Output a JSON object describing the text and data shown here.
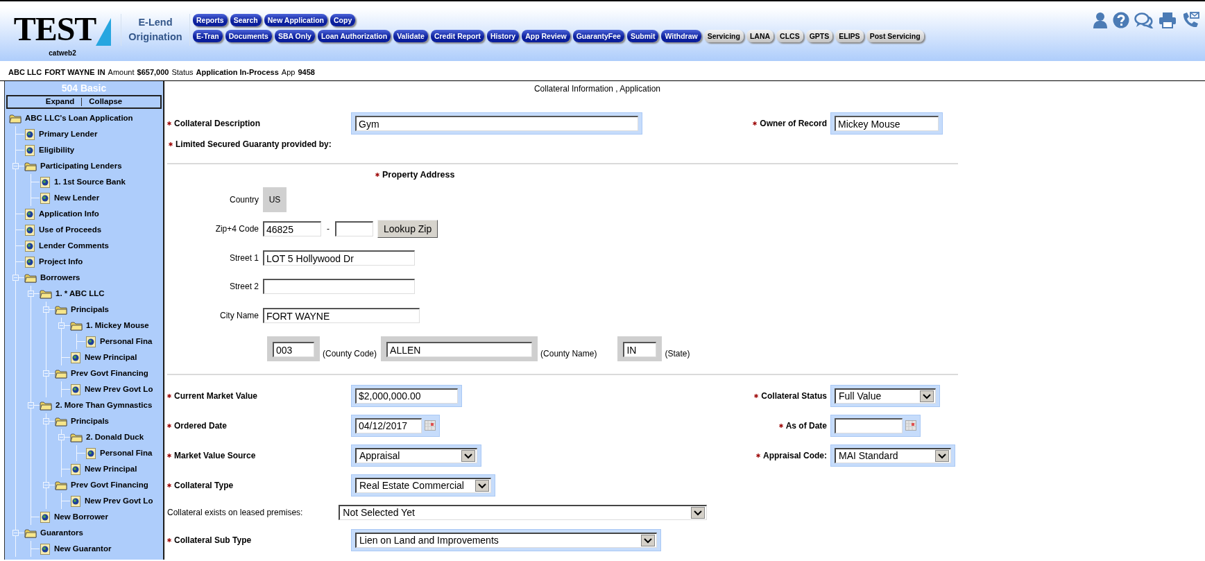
{
  "header": {
    "logo": {
      "text": "TEST",
      "subtitle": "catweb2"
    },
    "app_name": "E-Lend Origination",
    "nav_buttons": [
      [
        {
          "label": "Reports",
          "kind": "primary"
        },
        {
          "label": "Search",
          "kind": "primary"
        },
        {
          "label": "New Application",
          "kind": "primary"
        },
        {
          "label": "Copy",
          "kind": "primary"
        }
      ],
      [
        {
          "label": "E-Tran",
          "kind": "primary"
        },
        {
          "label": "Documents",
          "kind": "primary"
        },
        {
          "label": "SBA Only",
          "kind": "primary"
        },
        {
          "label": "Loan Authorization",
          "kind": "primary"
        },
        {
          "label": "Validate",
          "kind": "primary"
        },
        {
          "label": "Credit Report",
          "kind": "primary"
        },
        {
          "label": "History",
          "kind": "primary"
        },
        {
          "label": "App Review",
          "kind": "primary"
        },
        {
          "label": "GuarantyFee",
          "kind": "primary"
        },
        {
          "label": "Submit",
          "kind": "primary"
        },
        {
          "label": "Withdraw",
          "kind": "primary"
        },
        {
          "label": "Servicing",
          "kind": "secondary"
        },
        {
          "label": "LANA",
          "kind": "secondary"
        },
        {
          "label": "CLCS",
          "kind": "secondary"
        },
        {
          "label": "GPTS",
          "kind": "secondary"
        },
        {
          "label": "ELIPS",
          "kind": "secondary"
        },
        {
          "label": "Post Servicing",
          "kind": "secondary"
        }
      ]
    ]
  },
  "summary": [
    {
      "text": "ABC LLC",
      "kind": "value"
    },
    {
      "text": "FORT WAYNE",
      "kind": "value"
    },
    {
      "text": "IN",
      "kind": "value"
    },
    {
      "text": "Amount",
      "kind": "label"
    },
    {
      "text": "$657,000",
      "kind": "value"
    },
    {
      "text": "Status",
      "kind": "label"
    },
    {
      "text": "Application In-Process",
      "kind": "value"
    },
    {
      "text": "App",
      "kind": "label"
    },
    {
      "text": "9458",
      "kind": "value"
    }
  ],
  "sidebar": {
    "title": "504 Basic",
    "expand": "Expand",
    "collapse": "Collapse",
    "tree": [
      {
        "label": "ABC LLC's Loan Application",
        "kind": "folder",
        "children": [
          {
            "label": "Primary Lender",
            "kind": "page"
          },
          {
            "label": "Eligibility",
            "kind": "page"
          },
          {
            "label": "Participating Lenders",
            "kind": "folder",
            "children": [
              {
                "label": "1. 1st Source Bank",
                "kind": "page"
              },
              {
                "label": "New Lender",
                "kind": "page"
              }
            ]
          },
          {
            "label": "Application Info",
            "kind": "page"
          },
          {
            "label": "Use of Proceeds",
            "kind": "page"
          },
          {
            "label": "Lender Comments",
            "kind": "page"
          },
          {
            "label": "Project Info",
            "kind": "page"
          },
          {
            "label": "Borrowers",
            "kind": "folder",
            "children": [
              {
                "label": "1. * ABC LLC",
                "kind": "folder",
                "children": [
                  {
                    "label": "Principals",
                    "kind": "folder",
                    "children": [
                      {
                        "label": "1. Mickey Mouse",
                        "kind": "folder",
                        "children": [
                          {
                            "label": "Personal Fina",
                            "kind": "page"
                          }
                        ]
                      },
                      {
                        "label": "New Principal",
                        "kind": "page"
                      }
                    ]
                  },
                  {
                    "label": "Prev Govt Financing",
                    "kind": "folder",
                    "children": [
                      {
                        "label": "New Prev Govt Lo",
                        "kind": "page"
                      }
                    ]
                  }
                ]
              },
              {
                "label": "2. More Than Gymnastics",
                "kind": "folder",
                "children": [
                  {
                    "label": "Principals",
                    "kind": "folder",
                    "children": [
                      {
                        "label": "2. Donald Duck",
                        "kind": "folder",
                        "children": [
                          {
                            "label": "Personal Fina",
                            "kind": "page"
                          }
                        ]
                      },
                      {
                        "label": "New Principal",
                        "kind": "page"
                      }
                    ]
                  },
                  {
                    "label": "Prev Govt Financing",
                    "kind": "folder",
                    "children": [
                      {
                        "label": "New Prev Govt Lo",
                        "kind": "page"
                      }
                    ]
                  }
                ]
              },
              {
                "label": "New Borrower",
                "kind": "page"
              }
            ]
          },
          {
            "label": "Guarantors",
            "kind": "folder",
            "children": [
              {
                "label": "New Guarantor",
                "kind": "page"
              }
            ]
          }
        ]
      }
    ]
  },
  "form": {
    "title": "Collateral Information , Application",
    "collateral_description": {
      "label": "Collateral Description",
      "required": true,
      "value": "Gym"
    },
    "owner_of_record": {
      "label": "Owner of Record",
      "required": true,
      "value": "Mickey Mouse"
    },
    "limited_secured_guaranty": {
      "label": "Limited Secured Guaranty provided by:",
      "required": true
    },
    "property_address": {
      "title": "Property Address",
      "required": true,
      "country": {
        "label": "Country",
        "value": "US"
      },
      "zip": {
        "label": "Zip+4 Code",
        "value": "46825",
        "separator": "-",
        "button": "Lookup Zip"
      },
      "street_1": {
        "label": "Street 1",
        "value": "LOT 5 Hollywood Dr"
      },
      "street_2": {
        "label": "Street 2"
      },
      "city": {
        "label": "City Name",
        "value": "FORT WAYNE"
      },
      "county_code": {
        "label": "(County Code)",
        "value": "003"
      },
      "county_name": {
        "label": "(County Name)",
        "value": "ALLEN"
      },
      "state": {
        "label": "(State)",
        "value": "IN"
      }
    },
    "current_market_value": {
      "label": "Current Market Value",
      "required": true,
      "value": "$2,000,000.00"
    },
    "collateral_status": {
      "label": "Collateral Status",
      "required": true,
      "value": "Full Value"
    },
    "ordered_date": {
      "label": "Ordered Date",
      "required": true,
      "value": "04/12/2017"
    },
    "as_of_date": {
      "label": "As of Date",
      "required": true
    },
    "market_value_source": {
      "label": "Market Value Source",
      "required": true,
      "value": "Appraisal"
    },
    "appraisal_code": {
      "label": "Appraisal Code:",
      "required": true,
      "value": "MAI Standard"
    },
    "collateral_type": {
      "label": "Collateral Type",
      "required": true,
      "value": "Real Estate Commercial"
    },
    "leased_premises": {
      "label": "Collateral exists on leased premises:",
      "required": false,
      "value": "Not Selected Yet"
    },
    "collateral_sub_type": {
      "label": "Collateral Sub Type",
      "required": true,
      "value": "Lien on Land and Improvements"
    }
  }
}
